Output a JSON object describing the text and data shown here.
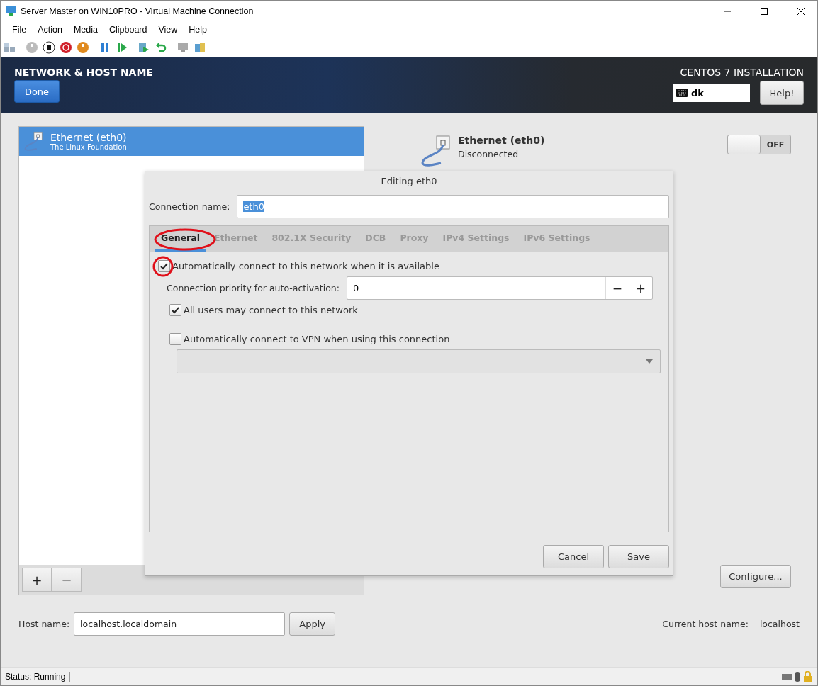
{
  "window": {
    "title": "Server Master on WIN10PRO - Virtual Machine Connection"
  },
  "menu": [
    "File",
    "Action",
    "Media",
    "Clipboard",
    "View",
    "Help"
  ],
  "header": {
    "title": "NETWORK & HOST NAME",
    "done": "Done",
    "product": "CENTOS 7 INSTALLATION",
    "keyboard": "dk",
    "help": "Help!"
  },
  "devices": [
    {
      "name": "Ethernet (eth0)",
      "vendor": "The Linux Foundation",
      "selected": true
    }
  ],
  "list_buttons": [
    "+",
    "−"
  ],
  "device_detail": {
    "name": "Ethernet (eth0)",
    "status": "Disconnected",
    "switch_label": "OFF",
    "on": false,
    "configure": "Configure..."
  },
  "dialog": {
    "title": "Editing eth0",
    "connection_name_label": "Connection name:",
    "connection_name": "eth0",
    "tabs": [
      {
        "label": "General",
        "selected": true
      },
      {
        "label": "Ethernet",
        "selected": false
      },
      {
        "label": "802.1X Security",
        "selected": false
      },
      {
        "label": "DCB",
        "selected": false
      },
      {
        "label": "Proxy",
        "selected": false
      },
      {
        "label": "IPv4 Settings",
        "selected": false
      },
      {
        "label": "IPv6 Settings",
        "selected": false
      }
    ],
    "auto_connect": {
      "label": "Automatically connect to this network when it is available",
      "checked": true
    },
    "priority": {
      "label": "Connection priority for auto-activation:",
      "value": "0",
      "minus": "−",
      "plus": "+"
    },
    "all_users": {
      "label": "All users may connect to this network",
      "checked": true
    },
    "vpn": {
      "label": "Automatically connect to VPN when using this connection",
      "checked": false
    },
    "buttons": [
      "Cancel",
      "Save"
    ]
  },
  "hostname": {
    "label": "Host name:",
    "value": "localhost.localdomain",
    "apply": "Apply",
    "current_label": "Current host name:",
    "current": "localhost"
  },
  "status_bar": {
    "text": "Status: Running"
  }
}
